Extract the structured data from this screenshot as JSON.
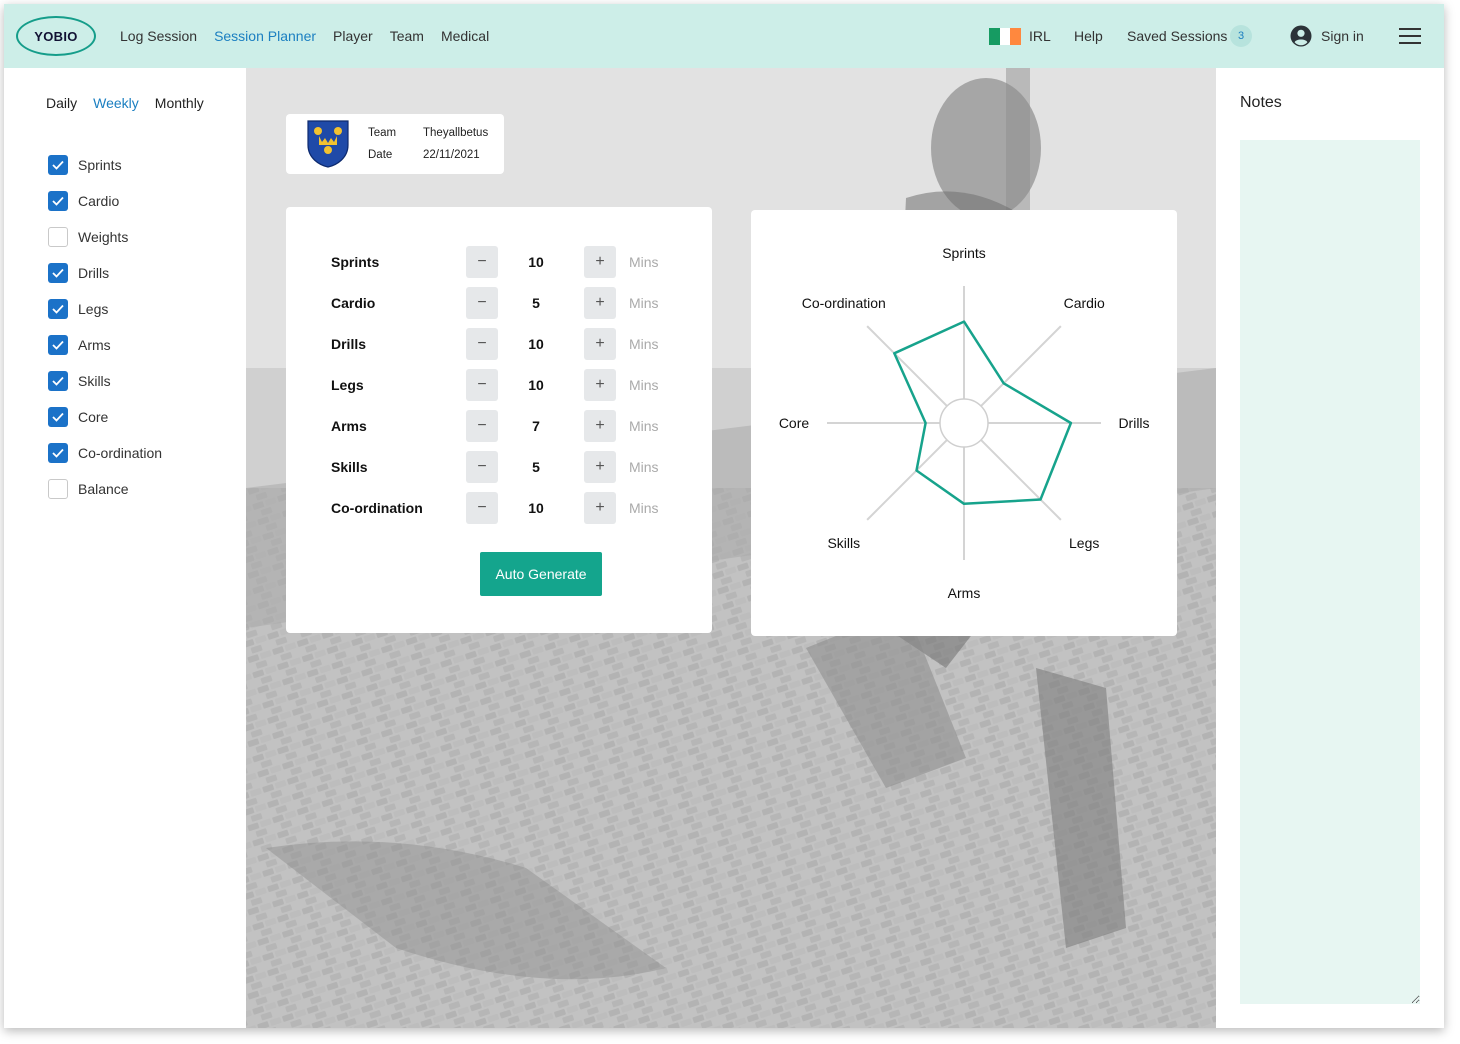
{
  "brand": {
    "logo_text": "YOBIO"
  },
  "nav": {
    "items": [
      {
        "label": "Log Session",
        "active": false
      },
      {
        "label": "Session Planner",
        "active": true
      },
      {
        "label": "Player",
        "active": false
      },
      {
        "label": "Team",
        "active": false
      },
      {
        "label": "Medical",
        "active": false
      }
    ],
    "country_code": "IRL",
    "help": "Help",
    "saved_sessions": "Saved Sessions",
    "saved_count": "3",
    "sign_in": "Sign in"
  },
  "sidebar": {
    "period_tabs": [
      {
        "label": "Daily",
        "active": false
      },
      {
        "label": "Weekly",
        "active": true
      },
      {
        "label": "Monthly",
        "active": false
      }
    ],
    "categories": [
      {
        "label": "Sprints",
        "checked": true
      },
      {
        "label": "Cardio",
        "checked": true
      },
      {
        "label": "Weights",
        "checked": false
      },
      {
        "label": "Drills",
        "checked": true
      },
      {
        "label": "Legs",
        "checked": true
      },
      {
        "label": "Arms",
        "checked": true
      },
      {
        "label": "Skills",
        "checked": true
      },
      {
        "label": "Core",
        "checked": true
      },
      {
        "label": "Co-ordination",
        "checked": true
      },
      {
        "label": "Balance",
        "checked": false
      }
    ]
  },
  "team_card": {
    "team_label": "Team",
    "team_value": "Theyallbetus",
    "date_label": "Date",
    "date_value": "22/11/2021"
  },
  "session": {
    "unit": "Mins",
    "rows": [
      {
        "name": "Sprints",
        "value": "10"
      },
      {
        "name": "Cardio",
        "value": "5"
      },
      {
        "name": "Drills",
        "value": "10"
      },
      {
        "name": "Legs",
        "value": "10"
      },
      {
        "name": "Arms",
        "value": "7"
      },
      {
        "name": "Skills",
        "value": "5"
      },
      {
        "name": "Co-ordination",
        "value": "10"
      }
    ],
    "auto_generate": "Auto Generate"
  },
  "chart_data": {
    "type": "radar",
    "axes": [
      "Sprints",
      "Cardio",
      "Drills",
      "Legs",
      "Arms",
      "Skills",
      "Core",
      "Co-ordination"
    ],
    "values": [
      0.74,
      0.41,
      0.78,
      0.79,
      0.59,
      0.49,
      0.28,
      0.72
    ],
    "range": [
      0,
      1
    ],
    "line_color": "#17a38c"
  },
  "notes": {
    "title": "Notes"
  },
  "colors": {
    "topbar": "#cdeee8",
    "accent": "#14a58d",
    "link_active": "#1b7fc1",
    "checkbox": "#1b72c8",
    "notes_bg": "#e7f6f2"
  },
  "flag_colors": [
    "#169b62",
    "#ffffff",
    "#ff883e"
  ]
}
